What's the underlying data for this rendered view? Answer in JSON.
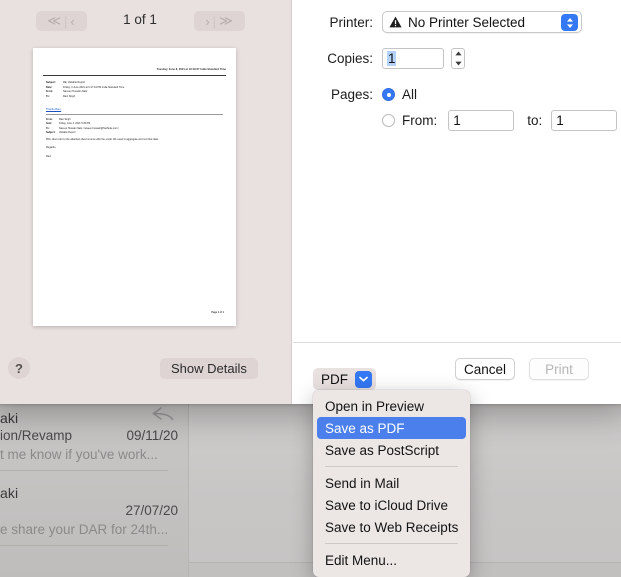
{
  "backdrop": {
    "mail_messages": [
      {
        "sender": "aki",
        "subject": "ion/Revamp",
        "date": "09/11/20",
        "snippet": "t me know if you've work...",
        "reply_icon": "reply-icon"
      },
      {
        "sender": "aki",
        "subject": "",
        "date": "27/07/20",
        "snippet": "e share your DAR for 24th...",
        "reply_icon": ""
      }
    ]
  },
  "print_dialog": {
    "preview": {
      "page_indicator": "1 of 1",
      "first_page_icon": "double-chevron-left-icon",
      "prev_page_icon": "chevron-left-icon",
      "next_page_icon": "chevron-right-icon",
      "last_page_icon": "double-chevron-right-icon",
      "help_label": "?",
      "show_details_label": "Show Details",
      "document": {
        "datestamp": "Tuesday, June 8, 2021 at 18:18:37 India Standard Time",
        "header_fields": [
          {
            "key": "Subject:",
            "value": "RE: Variable Report"
          },
          {
            "key": "Date:",
            "value": "Friday, 4 June 2021 at 6:17:44 PM India Standard Time"
          },
          {
            "key": "From:",
            "value": "Naveen Hussain Naik"
          },
          {
            "key": "To:",
            "value": "Ravi Singh"
          }
        ],
        "greeting_link": "Thanks Ravi,",
        "quoted_fields": [
          {
            "key": "From:",
            "value": "Ravi Singh"
          },
          {
            "key": "Sent:",
            "value": "Friday, June 4, 2021 5:45 PM"
          },
          {
            "key": "To:",
            "value": "Naveen Hussain Naik <naveen.hussain@NetSuite.com>"
          },
          {
            "key": "Subject:",
            "value": "Variable Report"
          }
        ],
        "body_paragraphs": [
          "PFA. Also refer to the attached sheet at once with the email. We need to aggregate and sort that data.",
          "Regards,",
          "Ravi"
        ],
        "page_number": "Page 1 of 1"
      }
    },
    "options": {
      "printer_label": "Printer:",
      "printer_value": "No Printer Selected",
      "printer_warning_icon": "warning-triangle-icon",
      "printer_chevron_icon": "chevron-up-down-icon",
      "copies_label": "Copies:",
      "copies_value": "1",
      "copies_stepper_icon": "stepper-up-down-icon",
      "pages_label": "Pages:",
      "pages_all_label": "All",
      "pages_all_selected": true,
      "pages_from_label": "From:",
      "pages_from_value": "1",
      "pages_to_label": "to:",
      "pages_to_value": "1"
    },
    "actions": {
      "pdf_button_label": "PDF",
      "pdf_chevron_icon": "chevron-down-icon",
      "cancel_label": "Cancel",
      "print_label": "Print",
      "print_disabled": true
    },
    "pdf_menu": {
      "items": [
        {
          "label": "Open in Preview",
          "selected": false,
          "separator_after": false
        },
        {
          "label": "Save as PDF",
          "selected": true,
          "separator_after": false
        },
        {
          "label": "Save as PostScript",
          "selected": false,
          "separator_after": true
        },
        {
          "label": "Send in Mail",
          "selected": false,
          "separator_after": false
        },
        {
          "label": "Save to iCloud Drive",
          "selected": false,
          "separator_after": false
        },
        {
          "label": "Save to Web Receipts",
          "selected": false,
          "separator_after": true
        },
        {
          "label": "Edit Menu...",
          "selected": false,
          "separator_after": false
        }
      ]
    }
  },
  "colors": {
    "accent_blue": "#3478f6",
    "menu_highlight": "#4b7fec",
    "sheet_sidebar": "#e9e1e0",
    "menu_bg": "#ece6e5"
  }
}
